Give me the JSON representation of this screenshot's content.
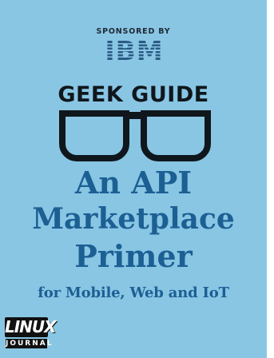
{
  "cover": {
    "sponsor_label": "SPONSORED BY",
    "sponsor_logo": "IBM",
    "series": "GEEK GUIDE",
    "title_lines": [
      "An API",
      "Marketplace",
      "Primer"
    ],
    "subtitle": "for Mobile, Web and IoT",
    "publisher_logo": {
      "top": "LINUX",
      "bottom": "JOURNAL"
    },
    "icons": [
      "glasses-icon"
    ],
    "colors": {
      "background": "#89c6e4",
      "title": "#1c5f93",
      "dark": "#0f171c",
      "ibm": "#2a5a84"
    }
  }
}
